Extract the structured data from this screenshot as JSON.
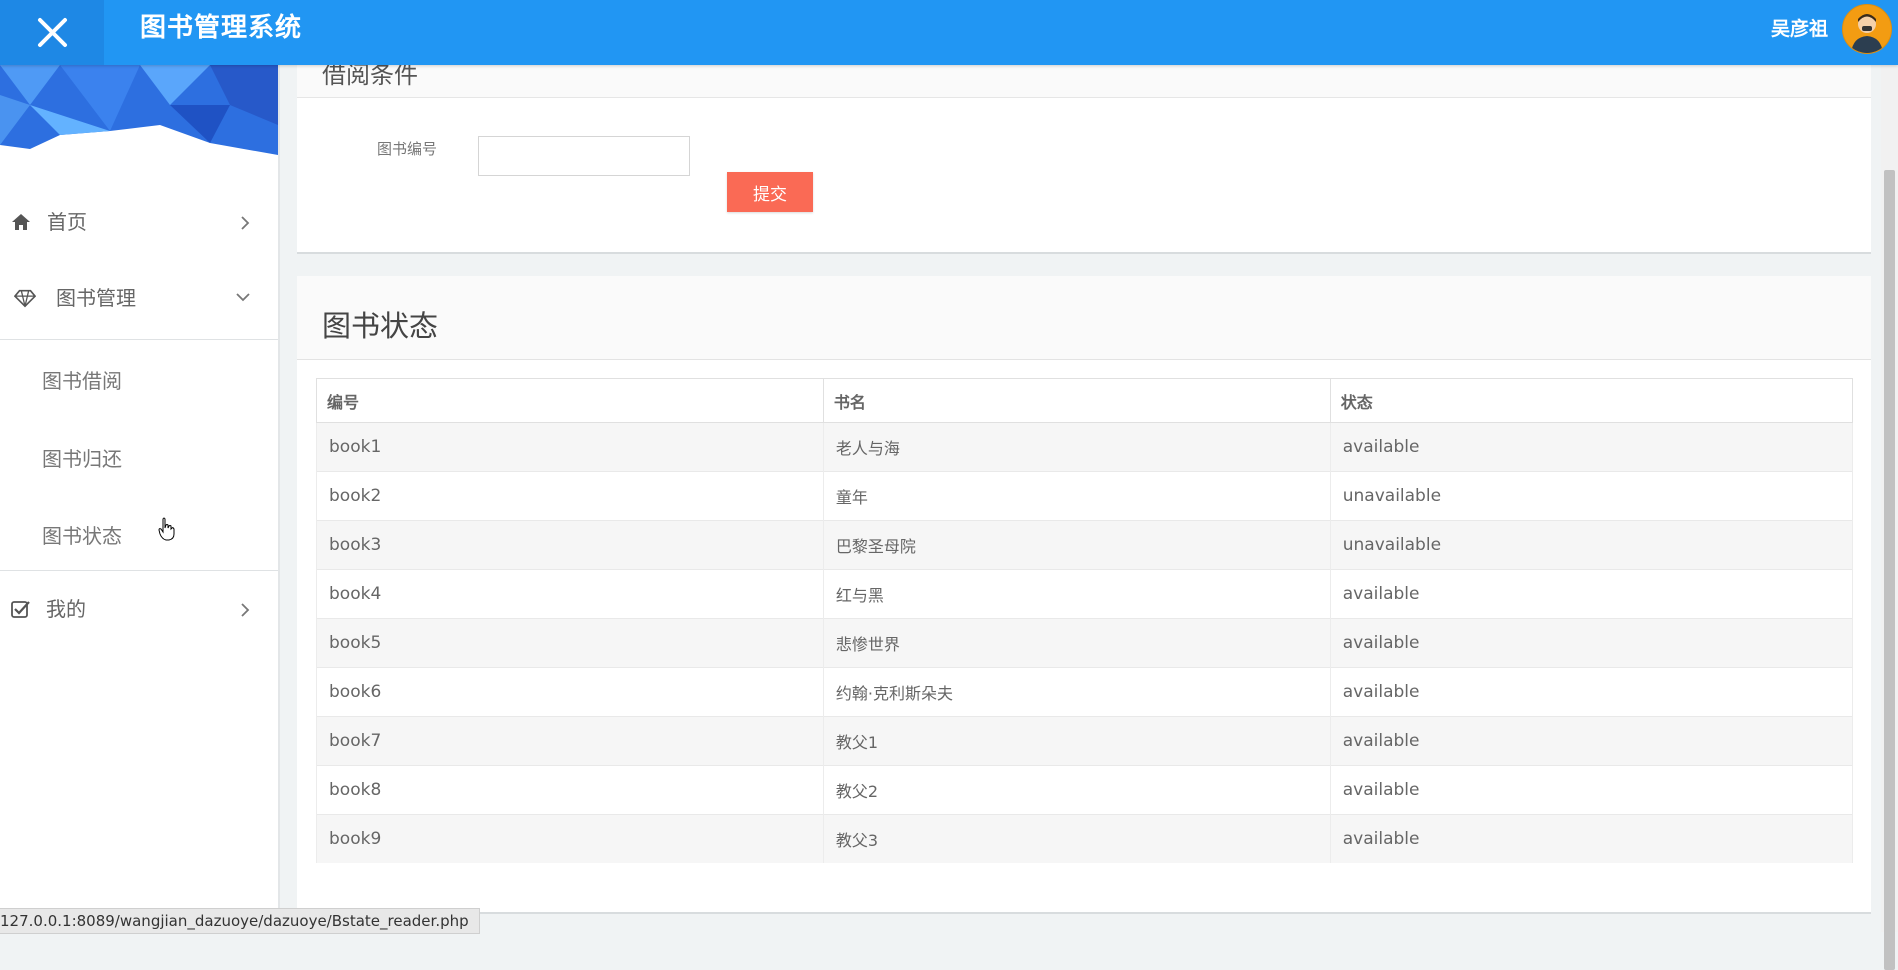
{
  "header": {
    "title": "图书管理系统",
    "username": "吴彦祖",
    "close_icon": "close-icon",
    "brand_color": "#2196f3"
  },
  "sidebar": {
    "items": [
      {
        "label": "首页",
        "icon": "home-icon"
      },
      {
        "label": "图书管理",
        "icon": "diamond-icon",
        "expanded": true,
        "children": [
          "图书借阅",
          "图书归还",
          "图书状态"
        ]
      },
      {
        "label": "我的",
        "icon": "checkbox-icon"
      }
    ]
  },
  "borrow_panel": {
    "title": "借阅条件",
    "field_label": "图书编号",
    "field_value": "",
    "submit_label": "提交",
    "submit_color": "#fa6a55"
  },
  "status_panel": {
    "title": "图书状态",
    "columns": [
      "编号",
      "书名",
      "状态"
    ],
    "rows": [
      {
        "id": "book1",
        "name": "老人与海",
        "status": "available"
      },
      {
        "id": "book2",
        "name": "童年",
        "status": "unavailable"
      },
      {
        "id": "book3",
        "name": "巴黎圣母院",
        "status": "unavailable"
      },
      {
        "id": "book4",
        "name": "红与黑",
        "status": "available"
      },
      {
        "id": "book5",
        "name": "悲惨世界",
        "status": "available"
      },
      {
        "id": "book6",
        "name": "约翰·克利斯朵夫",
        "status": "available"
      },
      {
        "id": "book7",
        "name": "教父1",
        "status": "available"
      },
      {
        "id": "book8",
        "name": "教父2",
        "status": "available"
      },
      {
        "id": "book9",
        "name": "教父3",
        "status": "available"
      }
    ]
  },
  "status_bar": {
    "url": "127.0.0.1:8089/wangjian_dazuoye/dazuoye/Bstate_reader.php"
  }
}
